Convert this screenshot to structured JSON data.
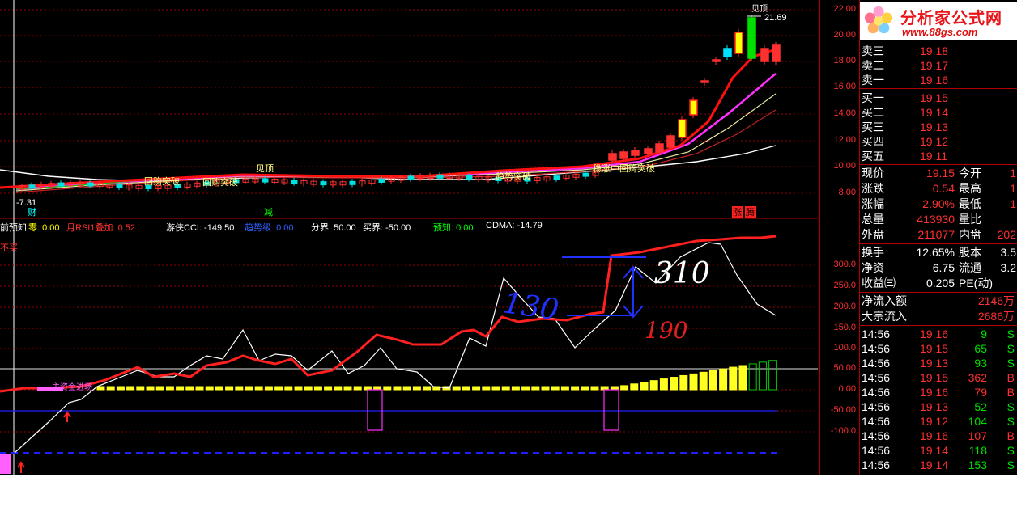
{
  "price_axis": {
    "ticks": [
      "22.00",
      "20.00",
      "18.00",
      "16.00",
      "14.00",
      "12.00",
      "10.00",
      "8.00"
    ]
  },
  "ind_axis": {
    "ticks": [
      "300.0",
      "250.0",
      "200.0",
      "150.0",
      "100.0",
      "50.00",
      "0.00",
      "-50.00",
      "-100.0"
    ]
  },
  "main_chart": {
    "high_label": "21.69",
    "low_label": "-7.31",
    "annotations": [
      "见顶",
      "回购突破",
      "回购突破",
      "趋势突破",
      "稳涨中回购突破"
    ],
    "bottom_labels": {
      "cai": "财",
      "jian": "减",
      "zhang": "涨",
      "teng": "腾"
    },
    "top_left_text": ""
  },
  "indicator_header": [
    {
      "text": "前预知",
      "color": "#ffffff"
    },
    {
      "text": "零: 0.00",
      "color": "#ffff00"
    },
    {
      "text": "月RSI1叠加: 0.52",
      "color": "#ff3030"
    },
    {
      "text": "游侠CCI: -149.50",
      "color": "#ffffff"
    },
    {
      "text": "趋势级: 0.00",
      "color": "#3060ff"
    },
    {
      "text": "分界: 50.00",
      "color": "#ffffff"
    },
    {
      "text": "买界: -50.00",
      "color": "#ffffff"
    },
    {
      "text": "预知: 0.00",
      "color": "#00ff00"
    },
    {
      "text": "CDMA: -14.79",
      "color": "#ffffff"
    }
  ],
  "indicator_side_label": "不买",
  "indicator_inline_label": "主资金进场",
  "handwriting": {
    "a": "130",
    "b": "310",
    "c": "190"
  },
  "logo": {
    "title": "分析家公式网",
    "url": "www.88gs.com"
  },
  "quote": {
    "asks": [
      {
        "label": "卖三",
        "price": "19.18"
      },
      {
        "label": "卖二",
        "price": "19.17"
      },
      {
        "label": "卖一",
        "price": "19.16"
      }
    ],
    "bids": [
      {
        "label": "买一",
        "price": "19.15"
      },
      {
        "label": "买二",
        "price": "19.14"
      },
      {
        "label": "买三",
        "price": "19.13"
      },
      {
        "label": "买四",
        "price": "19.12"
      },
      {
        "label": "买五",
        "price": "19.11"
      }
    ],
    "stats": [
      {
        "l1": "现价",
        "v1": "19.15",
        "l2": "今开",
        "v2": "1"
      },
      {
        "l1": "涨跌",
        "v1": "0.54",
        "l2": "最高",
        "v2": "1"
      },
      {
        "l1": "涨幅",
        "v1": "2.90%",
        "l2": "最低",
        "v2": "1"
      },
      {
        "l1": "总量",
        "v1": "413930",
        "l2": "量比",
        "v2": ""
      },
      {
        "l1": "外盘",
        "v1": "211077",
        "l2": "内盘",
        "v2": "202"
      }
    ],
    "stats2": [
      {
        "l1": "换手",
        "v1": "12.65%",
        "l2": "股本",
        "v2": "3.5"
      },
      {
        "l1": "净资",
        "v1": "6.75",
        "l2": "流通",
        "v2": "3.2"
      },
      {
        "l1": "收益㈢",
        "v1": "0.205",
        "l2": "PE(动)",
        "v2": ""
      }
    ],
    "flows": [
      {
        "label": "净流入额",
        "value": "2146万"
      },
      {
        "label": "大宗流入",
        "value": "2686万"
      }
    ],
    "ticks": [
      {
        "time": "14:56",
        "price": "19.16",
        "vol": "9",
        "side": "S"
      },
      {
        "time": "14:56",
        "price": "19.15",
        "vol": "65",
        "side": "S"
      },
      {
        "time": "14:56",
        "price": "19.13",
        "vol": "93",
        "side": "S"
      },
      {
        "time": "14:56",
        "price": "19.15",
        "vol": "362",
        "side": "B"
      },
      {
        "time": "14:56",
        "price": "19.16",
        "vol": "79",
        "side": "B"
      },
      {
        "time": "14:56",
        "price": "19.13",
        "vol": "52",
        "side": "S"
      },
      {
        "time": "14:56",
        "price": "19.12",
        "vol": "104",
        "side": "S"
      },
      {
        "time": "14:56",
        "price": "19.16",
        "vol": "107",
        "side": "B"
      },
      {
        "time": "14:56",
        "price": "19.14",
        "vol": "118",
        "side": "S"
      },
      {
        "time": "14:56",
        "price": "19.14",
        "vol": "153",
        "side": "S"
      }
    ]
  },
  "colors": {
    "up": "#ff3030",
    "down": "#00e000",
    "bg": "#000000",
    "grid": "#b00000",
    "text": "#ffffff",
    "price": "#ff3030"
  }
}
